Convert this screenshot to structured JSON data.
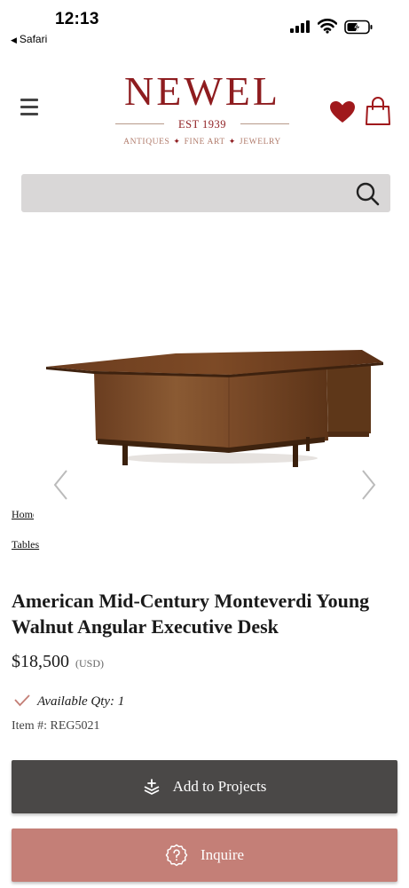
{
  "status_bar": {
    "time": "12:13",
    "back_app": "Safari"
  },
  "header": {
    "logo": {
      "word": "NEWEL",
      "est": "EST 1939",
      "tagline": [
        "ANTIQUES",
        "FINE ART",
        "JEWELRY"
      ]
    },
    "icons": [
      "menu-icon",
      "heart-icon",
      "shopping-bag-icon"
    ]
  },
  "search": {
    "placeholder": "",
    "value": ""
  },
  "breadcrumb": {
    "home": "Home",
    "category": "Tables"
  },
  "product": {
    "title": "American Mid-Century Monteverdi Young Walnut Angular Executive Desk",
    "price": "$18,500",
    "currency": "(USD)",
    "availability": "Available Qty: 1",
    "item_number": "Item #: REG5021"
  },
  "actions": {
    "add_to_projects": "Add to Projects",
    "inquire": "Inquire"
  },
  "colors": {
    "brand": "#8e1c1f",
    "heart": "#a0191c",
    "projects_button": "#4a4847",
    "inquire_button": "#c47f77",
    "search_bg": "#d9d7d7"
  }
}
